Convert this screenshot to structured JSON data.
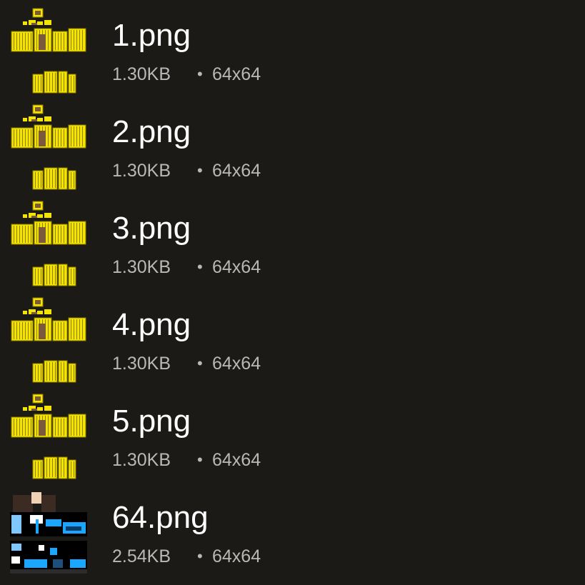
{
  "files": [
    {
      "name": "1.png",
      "size": "1.30KB",
      "dims": "64x64",
      "thumb": "gold-armor-thumbnail"
    },
    {
      "name": "2.png",
      "size": "1.30KB",
      "dims": "64x64",
      "thumb": "gold-armor-thumbnail"
    },
    {
      "name": "3.png",
      "size": "1.30KB",
      "dims": "64x64",
      "thumb": "gold-armor-thumbnail"
    },
    {
      "name": "4.png",
      "size": "1.30KB",
      "dims": "64x64",
      "thumb": "gold-armor-thumbnail"
    },
    {
      "name": "5.png",
      "size": "1.30KB",
      "dims": "64x64",
      "thumb": "gold-armor-thumbnail"
    },
    {
      "name": "64.png",
      "size": "2.54KB",
      "dims": "64x64",
      "thumb": "blue-skin-thumbnail"
    }
  ],
  "separator": "•",
  "colors": {
    "background": "#1c1a17",
    "title": "#ffffff",
    "meta": "#b8b8b8",
    "gold": "#f5e400",
    "gold_dark": "#8a7d00",
    "brown": "#7a5a3a",
    "blue": "#1aa7ff",
    "black": "#000000"
  }
}
